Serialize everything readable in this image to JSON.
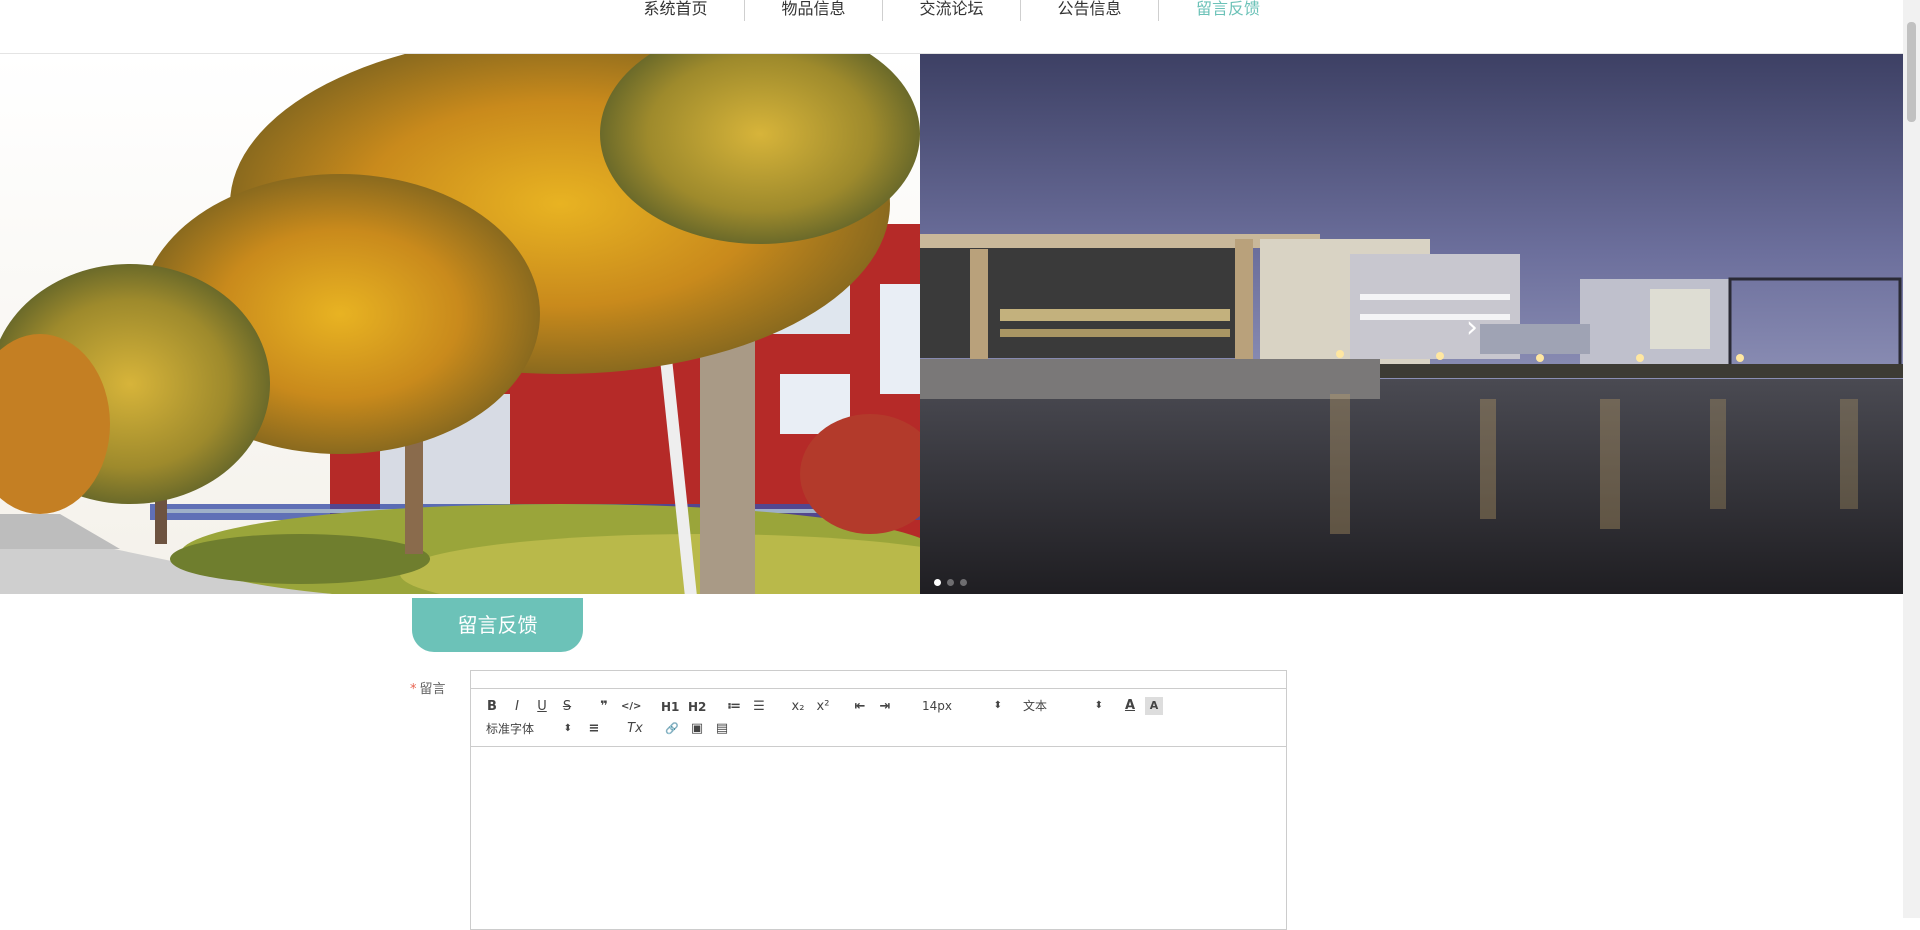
{
  "nav": {
    "items": [
      {
        "label": "系统首页",
        "active": false
      },
      {
        "label": "物品信息",
        "active": false
      },
      {
        "label": "交流论坛",
        "active": false
      },
      {
        "label": "公告信息",
        "active": false
      },
      {
        "label": "留言反馈",
        "active": true
      }
    ]
  },
  "carousel": {
    "slides": [
      "autumn-campus-trees-photo",
      "night-campus-lake-photo"
    ],
    "next_arrow": "›",
    "active_dot": 1,
    "dot_count": 3
  },
  "section": {
    "title": "留言反馈"
  },
  "form": {
    "required_mark": "*",
    "message_label": "留言",
    "toolbar": {
      "bold": "B",
      "italic": "I",
      "underline": "U",
      "strike": "S",
      "blockquote": "❞",
      "code": "</>",
      "h1": "H1",
      "h2": "H2",
      "ordered_list": "≔",
      "bullet_list": "☰",
      "subscript": "x₂",
      "superscript": "x²",
      "outdent": "⇤",
      "indent": "⇥",
      "size_value": "14px",
      "header_value": "文本",
      "font_color": "A",
      "background_color": "A",
      "font_family_value": "标准字体",
      "align": "≡",
      "clean": "Tx",
      "link": "🔗",
      "image": "▣",
      "video": "▤"
    }
  },
  "colors": {
    "accent": "#6cc2b8",
    "required": "#e8624f"
  }
}
